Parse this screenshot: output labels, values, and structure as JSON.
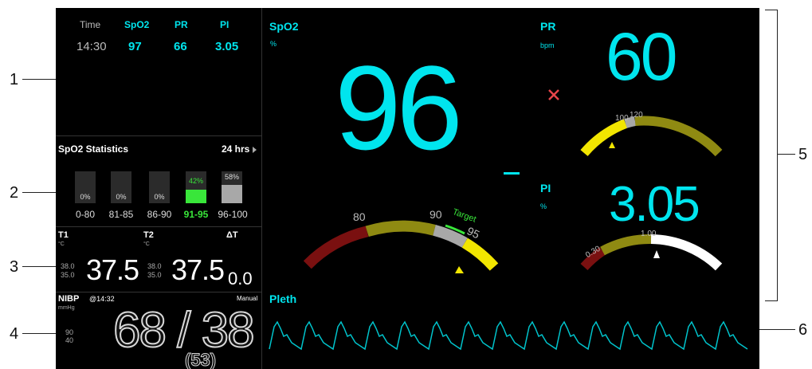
{
  "trend_table": {
    "headers": [
      "Time",
      "SpO2",
      "PR",
      "PI"
    ],
    "values": [
      "14:30",
      "97",
      "66",
      "3.05"
    ]
  },
  "spo2_stats": {
    "title": "SpO2 Statistics",
    "period": "24 hrs",
    "ranges": [
      {
        "label": "0-80",
        "pct_text": "0%",
        "pct": 0
      },
      {
        "label": "81-85",
        "pct_text": "0%",
        "pct": 0
      },
      {
        "label": "86-90",
        "pct_text": "0%",
        "pct": 0
      },
      {
        "label": "91-95",
        "pct_text": "42%",
        "pct": 42,
        "highlight": true
      },
      {
        "label": "96-100",
        "pct_text": "58%",
        "pct": 58
      }
    ]
  },
  "temp": {
    "t1_label": "T1",
    "t1_unit": "°C",
    "t1_hi": "38.0",
    "t1_lo": "35.0",
    "t1_value": "37.5",
    "t2_label": "T2",
    "t2_unit": "°C",
    "t2_hi": "38.0",
    "t2_lo": "35.0",
    "t2_value": "37.5",
    "dt_label": "ΔT",
    "dt_value": "0.0"
  },
  "nibp": {
    "label": "NIBP",
    "unit": "mmHg",
    "time": "@14:32",
    "mode": "Manual",
    "hi": "90",
    "lo": "40",
    "value": "68 / 38",
    "mean": "(53)"
  },
  "spo2": {
    "label": "SpO2",
    "unit": "%",
    "value": "96",
    "gauge_labels": [
      "80",
      "90",
      "95"
    ],
    "target_label": "Target"
  },
  "pr": {
    "label": "PR",
    "unit": "bpm",
    "value": "60",
    "gauge_labels": [
      "100",
      "120"
    ]
  },
  "pi": {
    "label": "PI",
    "unit": "%",
    "value": "3.05",
    "gauge_labels": [
      "0.30",
      "1.00"
    ]
  },
  "pleth": {
    "label": "Pleth"
  },
  "callouts": [
    "1",
    "2",
    "3",
    "4",
    "5",
    "6"
  ],
  "colors": {
    "cyan": "#00e5ee",
    "green": "#39e63a",
    "yellow": "#f2e600",
    "olive": "#8f8a12",
    "darkred": "#7a1010",
    "gray": "#a8a8a8",
    "white": "#ffffff"
  }
}
